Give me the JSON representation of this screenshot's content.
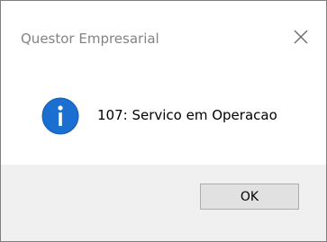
{
  "window": {
    "title": "Questor Empresarial",
    "close_icon": "close-icon"
  },
  "dialog": {
    "icon": "info-icon",
    "message": "107: Servico em Operacao"
  },
  "buttons": {
    "ok_label": "OK"
  },
  "colors": {
    "icon_blue": "#1a6fd1",
    "title_text": "#838383",
    "footer_bg": "#f0f0f0",
    "button_bg": "#e1e1e1",
    "button_border": "#adadad"
  }
}
